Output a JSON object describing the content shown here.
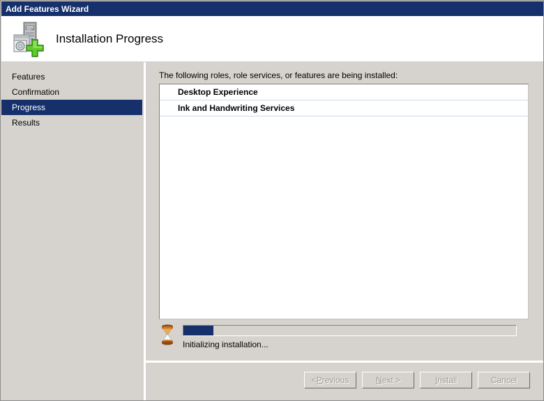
{
  "window": {
    "title": "Add Features Wizard"
  },
  "header": {
    "title": "Installation Progress",
    "icon": "server-add-icon"
  },
  "sidebar": {
    "items": [
      {
        "label": "Features",
        "selected": false
      },
      {
        "label": "Confirmation",
        "selected": false
      },
      {
        "label": "Progress",
        "selected": true
      },
      {
        "label": "Results",
        "selected": false
      }
    ]
  },
  "content": {
    "intro": "The following roles, role services, or features are being installed:",
    "items": [
      {
        "label": "Desktop Experience"
      },
      {
        "label": "Ink and Handwriting Services"
      }
    ]
  },
  "progress": {
    "icon": "hourglass-icon",
    "percent": 9,
    "status": "Initializing installation..."
  },
  "footer": {
    "buttons": [
      {
        "name": "previous-button",
        "pre": "< ",
        "acc": "P",
        "post": "revious",
        "disabled": true
      },
      {
        "name": "next-button",
        "pre": "",
        "acc": "N",
        "post": "ext >",
        "disabled": true
      },
      {
        "name": "install-button",
        "pre": "",
        "acc": "I",
        "post": "nstall",
        "disabled": true
      },
      {
        "name": "cancel-button",
        "pre": "Cancel",
        "acc": "",
        "post": "",
        "disabled": true
      }
    ]
  },
  "colors": {
    "titlebar": "#15306b",
    "accent": "#15306b",
    "window_bg": "#d6d3ce",
    "list_separator": "#c9dcef"
  }
}
